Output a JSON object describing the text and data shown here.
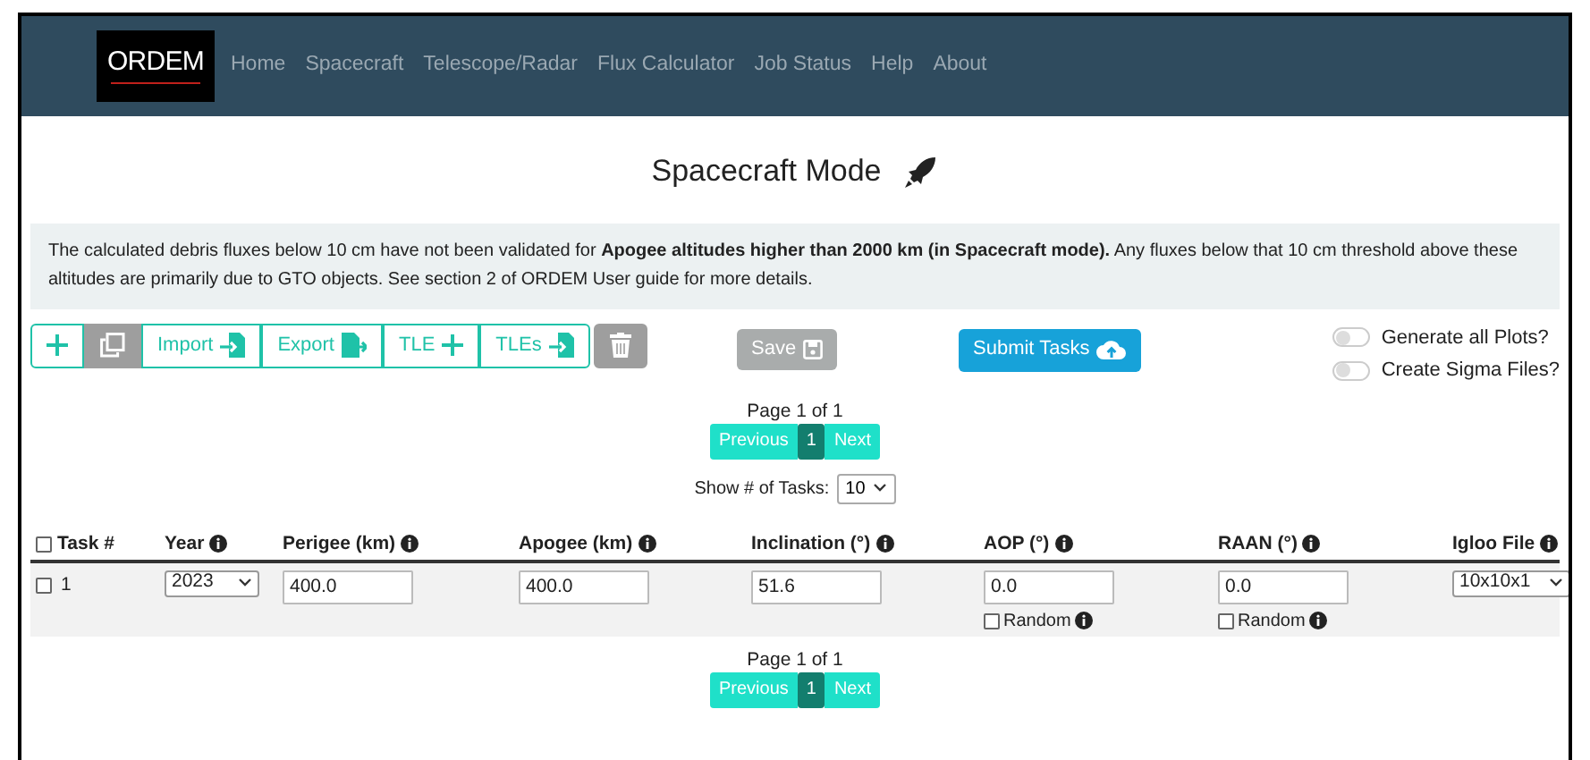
{
  "navbar": {
    "logo": "ORDEM",
    "items": [
      {
        "label": "Home"
      },
      {
        "label": "Spacecraft"
      },
      {
        "label": "Telescope/Radar"
      },
      {
        "label": "Flux Calculator"
      },
      {
        "label": "Job Status"
      },
      {
        "label": "Help"
      },
      {
        "label": "About"
      }
    ]
  },
  "title": "Spacecraft Mode",
  "alert": "The calculated debris fluxes below 10 cm have not been validated for **Apogee altitudes higher than 2000 km (in Spacecraft mode).** Any fluxes below that 10 cm threshold above these altitudes are primarily due to GTO objects. See section 2 of ORDEM User guide for more details.",
  "toolbar": [
    {
      "kind": "add"
    },
    {
      "kind": "copy"
    },
    {
      "kind": "import",
      "label": "Import"
    },
    {
      "kind": "export",
      "label": "Export"
    },
    {
      "kind": "tle",
      "label": "TLE"
    },
    {
      "kind": "tles",
      "label": "TLEs"
    },
    {
      "kind": "delete"
    }
  ],
  "save_button": {
    "label": "Save",
    "disabled": true
  },
  "submit_button": {
    "label": "Submit Tasks"
  },
  "toggles": [
    {
      "label": "Generate all Plots?",
      "on": false
    },
    {
      "label": "Create Sigma Files?",
      "on": false
    }
  ],
  "pagination_top": {
    "page_text": "Page 1 of 1",
    "buttons": [
      {
        "label": "Previous",
        "selected": false
      },
      {
        "label": "1",
        "selected": true
      },
      {
        "label": "Next",
        "selected": false
      }
    ]
  },
  "show_tasks": {
    "label": "Show # of Tasks:",
    "value": "10"
  },
  "table": {
    "columns": [
      {
        "label": "Task #",
        "kind": "check",
        "checked": false
      },
      {
        "label": "Year",
        "kind": "info"
      },
      {
        "label": "Perigee (km)",
        "kind": "info"
      },
      {
        "label": "Apogee (km)",
        "kind": "info"
      },
      {
        "label": "Inclination (°)",
        "kind": "info"
      },
      {
        "label": "AOP (°)",
        "kind": "info"
      },
      {
        "label": "RAAN (°)",
        "kind": "info"
      },
      {
        "label": "Igloo File",
        "kind": "info"
      }
    ],
    "rows": [
      {
        "checked": false,
        "task": "1",
        "year": "2023",
        "perigee": "400.0",
        "apogee": "400.0",
        "inclination": "51.6",
        "aop": {
          "value": "0.0",
          "random_label": "Random",
          "random": false
        },
        "raan": {
          "value": "0.0",
          "random_label": "Random",
          "random": false
        },
        "igloo": "10x10x1"
      }
    ]
  },
  "pagination_bottom": {
    "page_text": "Page 1 of 1",
    "buttons": [
      {
        "label": "Previous",
        "selected": false
      },
      {
        "label": "1",
        "selected": true
      },
      {
        "label": "Next",
        "selected": false
      }
    ]
  }
}
